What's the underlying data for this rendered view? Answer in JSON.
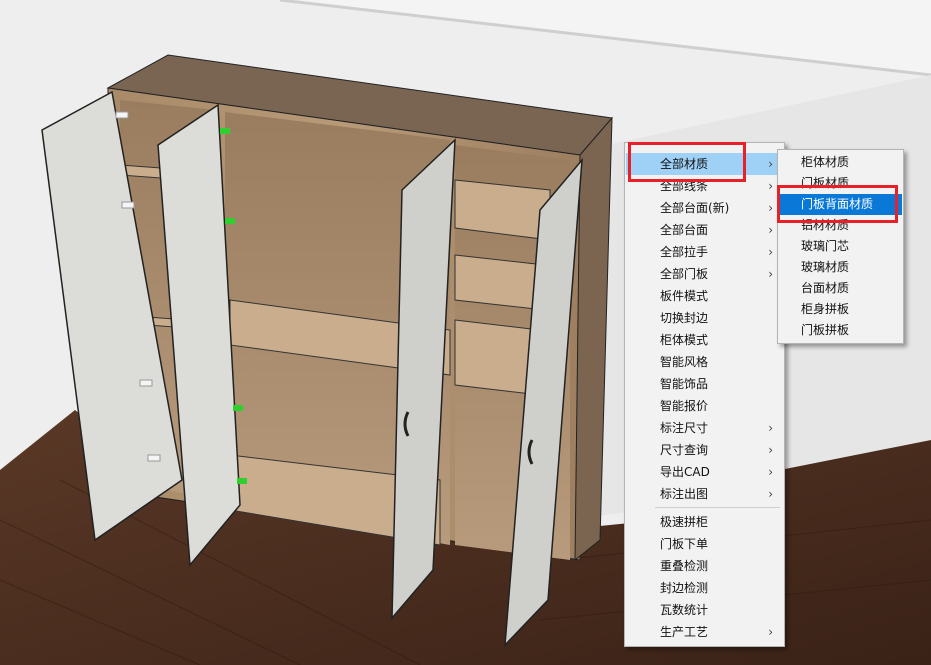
{
  "context_menu": {
    "items": [
      {
        "label": "全部材质",
        "submenu": true
      },
      {
        "label": "全部线条",
        "submenu": true
      },
      {
        "label": "全部台面(新)",
        "submenu": true
      },
      {
        "label": "全部台面",
        "submenu": true
      },
      {
        "label": "全部拉手",
        "submenu": true
      },
      {
        "label": "全部门板",
        "submenu": true
      },
      {
        "label": "板件模式",
        "submenu": false
      },
      {
        "label": "切换封边",
        "submenu": false
      },
      {
        "label": "柜体模式",
        "submenu": false
      },
      {
        "label": "智能风格",
        "submenu": false
      },
      {
        "label": "智能饰品",
        "submenu": false
      },
      {
        "label": "智能报价",
        "submenu": false
      },
      {
        "label": "标注尺寸",
        "submenu": true
      },
      {
        "label": "尺寸查询",
        "submenu": true
      },
      {
        "label": "导出CAD",
        "submenu": true
      },
      {
        "label": "标注出图",
        "submenu": true
      },
      {
        "label": "极速拼柜",
        "submenu": false
      },
      {
        "label": "门板下单",
        "submenu": false
      },
      {
        "label": "重叠检测",
        "submenu": false
      },
      {
        "label": "封边检测",
        "submenu": false
      },
      {
        "label": "瓦数统计",
        "submenu": false
      },
      {
        "label": "生产工艺",
        "submenu": true
      }
    ],
    "arrow_glyph": "›"
  },
  "submenu": {
    "items": [
      {
        "label": "柜体材质"
      },
      {
        "label": "门板材质"
      },
      {
        "label": "门板背面材质"
      },
      {
        "label": "铝材材质"
      },
      {
        "label": "玻璃门芯"
      },
      {
        "label": "玻璃材质"
      },
      {
        "label": "台面材质"
      },
      {
        "label": "柜身拼板"
      },
      {
        "label": "门板拼板"
      }
    ]
  },
  "colors": {
    "highlight_main": "#9fd0f5",
    "highlight_sub": "#0a78d7",
    "annotation_red": "#e8202a",
    "floor": "#4a2c1c",
    "wood": "#a8896a",
    "door": "#d8d8d4"
  }
}
